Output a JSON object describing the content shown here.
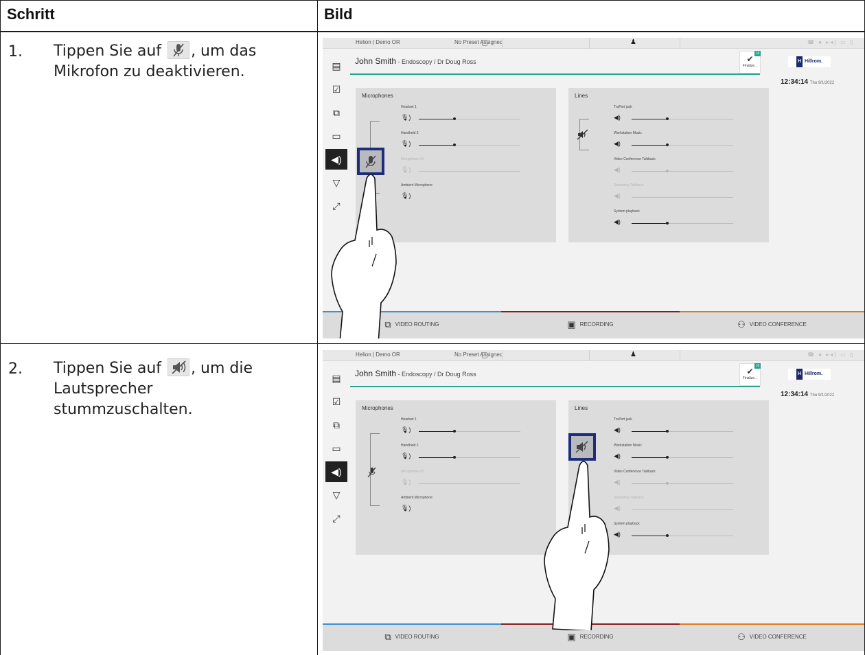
{
  "table": {
    "header_step": "Schritt",
    "header_image": "Bild"
  },
  "steps": [
    {
      "number": "1.",
      "text_before": "Tippen Sie auf",
      "icon": "microphone-muted-icon",
      "text_after": ", um das Mikrofon zu deaktivieren."
    },
    {
      "number": "2.",
      "text_before": "Tippen Sie auf",
      "icon": "speaker-muted-icon",
      "text_after": ", um die Lautsprecher stummzuschalten."
    }
  ],
  "screen": {
    "location": "Helion | Demo OR",
    "preset": "No Preset Assigned",
    "patient_name": "John Smith",
    "patient_details": " - Endoscopy / Dr Doug Ross",
    "finalize_label": "Finalize...",
    "finalize_badge": "10",
    "brand": "Hillrom.",
    "brand_mark": "H",
    "time": "12:34:14",
    "date": "Thu 9/1/2022",
    "microphones": {
      "title": "Microphones",
      "channels": [
        {
          "label": "Headset 1",
          "level": 0.35,
          "muted": false
        },
        {
          "label": "Handheld 2",
          "level": 0.35,
          "muted": false
        },
        {
          "label": "Microphone #3",
          "level": 0.0,
          "muted": true
        },
        {
          "label": "Ambient Microphone",
          "level": null,
          "muted": false
        }
      ]
    },
    "lines": {
      "title": "Lines",
      "channels": [
        {
          "label": "TruPort jack",
          "level": 0.35,
          "muted": false
        },
        {
          "label": "Workstation Music",
          "level": 0.35,
          "muted": false
        },
        {
          "label": "Video Conference Talkback",
          "level": 0.35,
          "muted": true
        },
        {
          "label": "Streaming Talkback",
          "level": 0.0,
          "muted": true
        },
        {
          "label": "System playback",
          "level": 0.35,
          "muted": false
        }
      ]
    },
    "tabs": [
      {
        "label": "VIDEO ROUTING",
        "color": "#3b8fd6"
      },
      {
        "label": "RECORDING",
        "color": "#8a1c1c"
      },
      {
        "label": "VIDEO CONFERENCE",
        "color": "#e07b1a"
      }
    ]
  }
}
